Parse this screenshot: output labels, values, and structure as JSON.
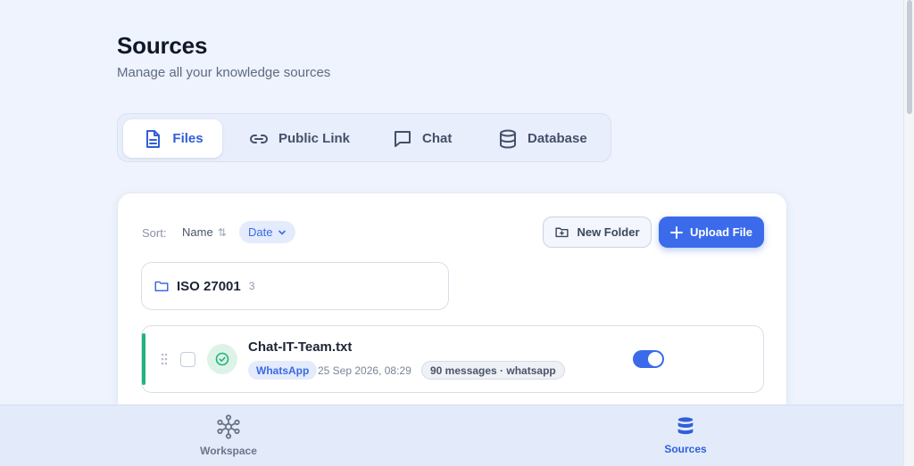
{
  "header": {
    "title": "Sources",
    "subtitle": "Manage all your knowledge sources"
  },
  "tabs": [
    {
      "label": "Files",
      "icon": "file-icon",
      "active": true
    },
    {
      "label": "Public Link",
      "icon": "link-icon",
      "active": false
    },
    {
      "label": "Chat",
      "icon": "chat-icon",
      "active": false
    },
    {
      "label": "Database",
      "icon": "database-icon",
      "active": false
    }
  ],
  "toolbar": {
    "sort_label": "Sort:",
    "sort_name": "Name",
    "sort_date": "Date",
    "new_folder": "New Folder",
    "upload_file": "Upload File"
  },
  "folders": [
    {
      "name": "ISO 27001",
      "count": "3"
    }
  ],
  "files": [
    {
      "name": "Chat-IT-Team.txt",
      "source": "WhatsApp",
      "date": "25 Sep 2026, 08:29",
      "meta": "90 messages · whatsapp",
      "status": "synced",
      "enabled": true
    }
  ],
  "bottom_nav": [
    {
      "label": "Workspace",
      "icon": "workspace-icon",
      "active": false
    },
    {
      "label": "Sources",
      "icon": "database-icon",
      "active": true
    }
  ],
  "colors": {
    "accent": "#3b6bea",
    "background": "#eef3fd",
    "success": "#1fb57a"
  }
}
